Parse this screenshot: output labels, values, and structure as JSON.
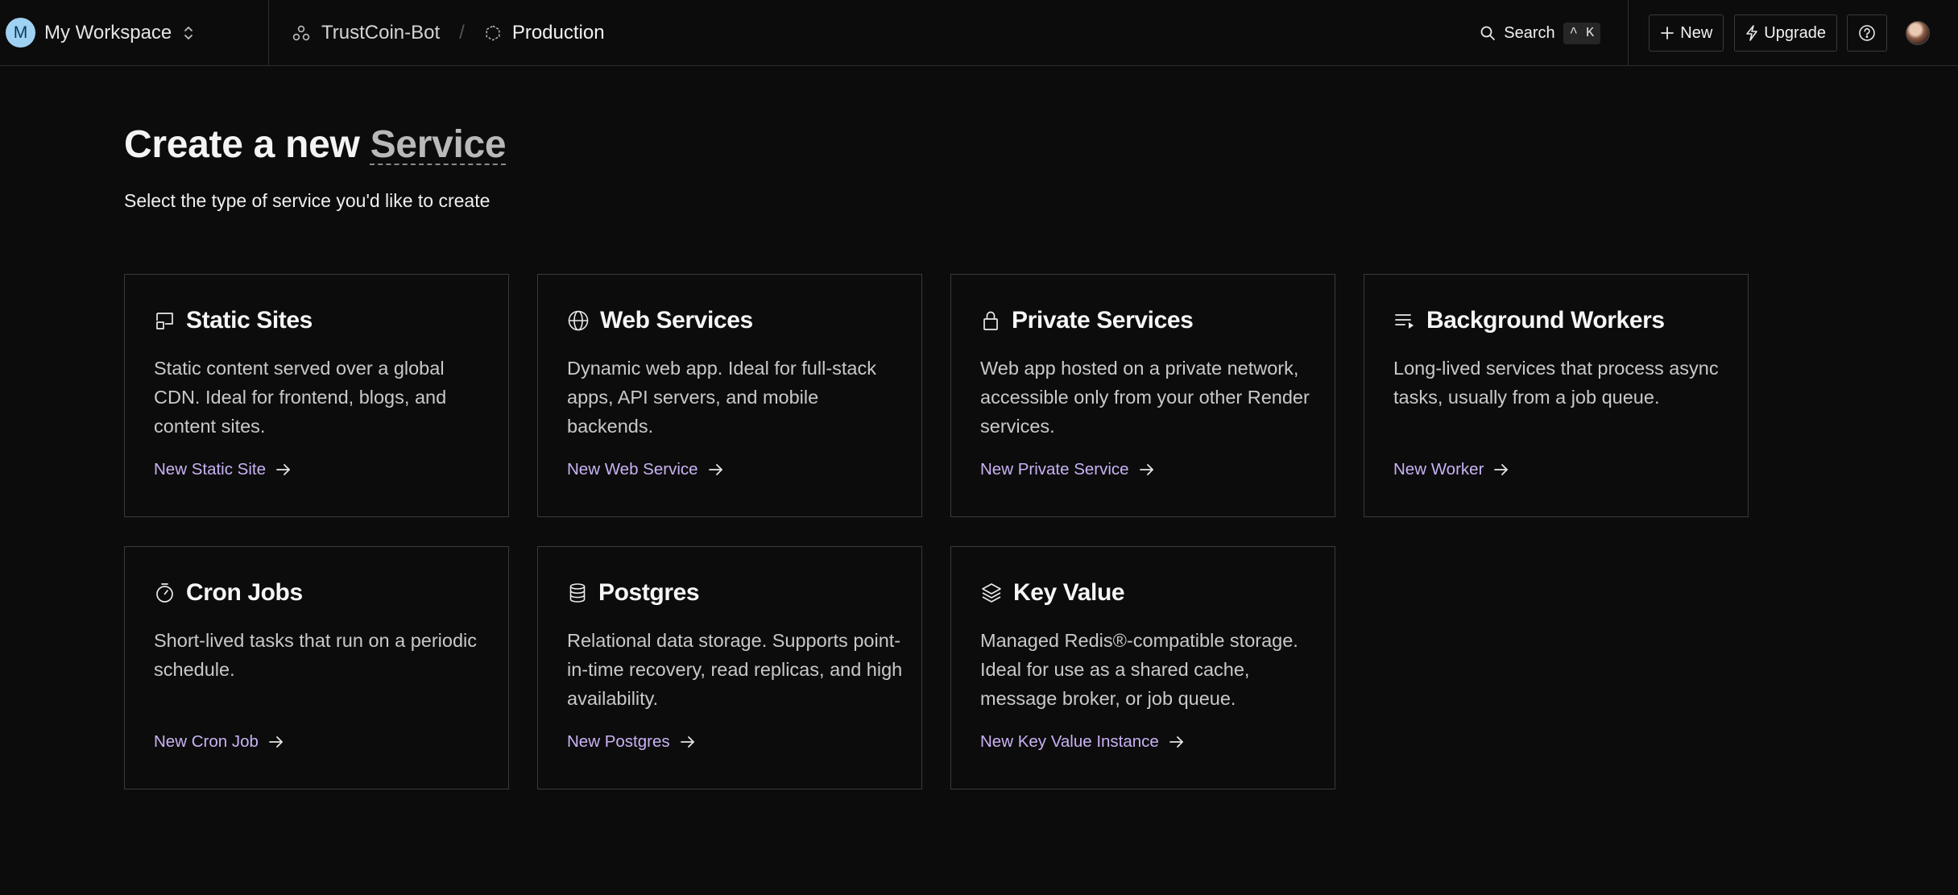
{
  "workspace": {
    "initial": "M",
    "name": "My Workspace"
  },
  "breadcrumb": {
    "project": "TrustCoin-Bot",
    "separator": "/",
    "environment": "Production"
  },
  "toolbar": {
    "search_label": "Search",
    "search_shortcut": "^ K",
    "new_label": "New",
    "upgrade_label": "Upgrade"
  },
  "page": {
    "title_prefix": "Create a new",
    "title_highlight": "Service",
    "subtitle": "Select the type of service you'd like to create"
  },
  "cards": [
    {
      "title": "Static Sites",
      "icon": "static-site-icon",
      "description": "Static content served over a global CDN. Ideal for frontend, blogs, and content sites.",
      "link": "New Static Site"
    },
    {
      "title": "Web Services",
      "icon": "globe-icon",
      "description": "Dynamic web app. Ideal for full-stack apps, API servers, and mobile backends.",
      "link": "New Web Service"
    },
    {
      "title": "Private Services",
      "icon": "lock-icon",
      "description": "Web app hosted on a private network, accessible only from your other Render services.",
      "link": "New Private Service"
    },
    {
      "title": "Background Workers",
      "icon": "queue-icon",
      "description": "Long-lived services that process async tasks, usually from a job queue.",
      "link": "New Worker"
    },
    {
      "title": "Cron Jobs",
      "icon": "timer-icon",
      "description": "Short-lived tasks that run on a periodic schedule.",
      "link": "New Cron Job"
    },
    {
      "title": "Postgres",
      "icon": "database-icon",
      "description": "Relational data storage. Supports point-in-time recovery, read replicas, and high availability.",
      "link": "New Postgres"
    },
    {
      "title": "Key Value",
      "icon": "layers-icon",
      "description": "Managed Redis®-compatible storage. Ideal for use as a shared cache, message broker, or job queue.",
      "link": "New Key Value Instance"
    }
  ],
  "colors": {
    "background": "#0c0c0c",
    "border": "#3a3a3a",
    "link": "#c9b2f4",
    "workspace_avatar": "#9fd1f2"
  }
}
